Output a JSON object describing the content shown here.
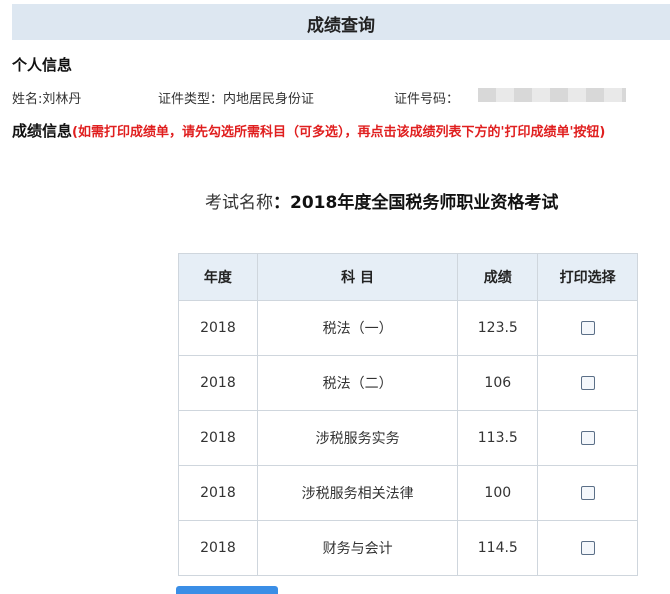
{
  "header": {
    "title": "成绩查询"
  },
  "personal": {
    "heading": "个人信息",
    "name_text": "姓名:刘林丹",
    "id_type_text": "证件类型：内地居民身份证",
    "id_number_label": "证件号码："
  },
  "scores_section": {
    "heading": "成绩信息",
    "note": "(如需打印成绩单，请先勾选所需科目（可多选），再点击该成绩列表下方的'打印成绩单'按钮)"
  },
  "exam": {
    "label": "考试名称",
    "colon": "：",
    "name": "2018年度全国税务师职业资格考试"
  },
  "table": {
    "headers": [
      "年度",
      "科 目",
      "成绩",
      "打印选择"
    ],
    "rows": [
      {
        "year": "2018",
        "subject": "税法（一）",
        "score": "123.5",
        "checked": false
      },
      {
        "year": "2018",
        "subject": "税法（二）",
        "score": "106",
        "checked": false
      },
      {
        "year": "2018",
        "subject": "涉税服务实务",
        "score": "113.5",
        "checked": false
      },
      {
        "year": "2018",
        "subject": "涉税服务相关法律",
        "score": "100",
        "checked": false
      },
      {
        "year": "2018",
        "subject": "财务与会计",
        "score": "114.5",
        "checked": false
      }
    ]
  },
  "colors": {
    "title_bar": "#dde7f1",
    "header_row": "#e6eef6",
    "note_red": "#e01f1f",
    "button_blue": "#3a8ee6"
  }
}
